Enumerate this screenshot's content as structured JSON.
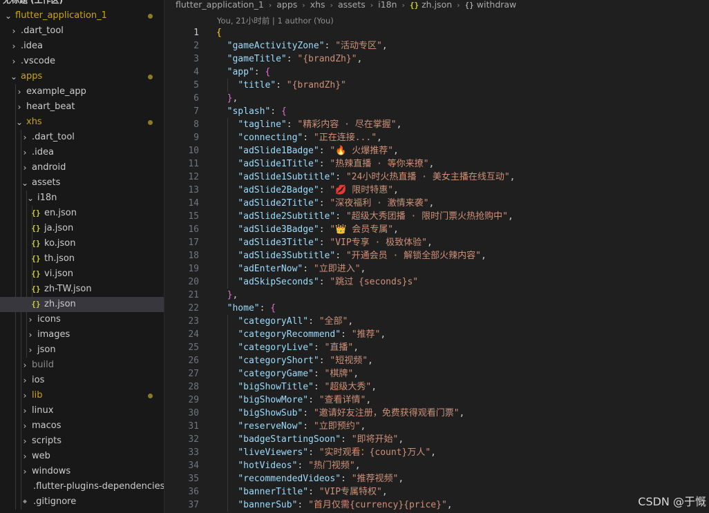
{
  "sidebar": {
    "workspace_label": "无标题 (工作区)",
    "tree": [
      {
        "label": "flutter_application_1",
        "depth": 0,
        "type": "folder",
        "open": true,
        "git": true,
        "dot": true
      },
      {
        "label": ".dart_tool",
        "depth": 1,
        "type": "folder",
        "open": false
      },
      {
        "label": ".idea",
        "depth": 1,
        "type": "folder",
        "open": false
      },
      {
        "label": ".vscode",
        "depth": 1,
        "type": "folder",
        "open": false
      },
      {
        "label": "apps",
        "depth": 1,
        "type": "folder",
        "open": true,
        "git": true,
        "dot": true
      },
      {
        "label": "example_app",
        "depth": 2,
        "type": "folder",
        "open": false
      },
      {
        "label": "heart_beat",
        "depth": 2,
        "type": "folder",
        "open": false
      },
      {
        "label": "xhs",
        "depth": 2,
        "type": "folder",
        "open": true,
        "git": true,
        "dot": true
      },
      {
        "label": ".dart_tool",
        "depth": 3,
        "type": "folder",
        "open": false
      },
      {
        "label": ".idea",
        "depth": 3,
        "type": "folder",
        "open": false
      },
      {
        "label": "android",
        "depth": 3,
        "type": "folder",
        "open": false
      },
      {
        "label": "assets",
        "depth": 3,
        "type": "folder",
        "open": true
      },
      {
        "label": "i18n",
        "depth": 4,
        "type": "folder",
        "open": true
      },
      {
        "label": "en.json",
        "depth": 5,
        "type": "json"
      },
      {
        "label": "ja.json",
        "depth": 5,
        "type": "json"
      },
      {
        "label": "ko.json",
        "depth": 5,
        "type": "json"
      },
      {
        "label": "th.json",
        "depth": 5,
        "type": "json"
      },
      {
        "label": "vi.json",
        "depth": 5,
        "type": "json"
      },
      {
        "label": "zh-TW.json",
        "depth": 5,
        "type": "json"
      },
      {
        "label": "zh.json",
        "depth": 5,
        "type": "json",
        "selected": true
      },
      {
        "label": "icons",
        "depth": 4,
        "type": "folder",
        "open": false
      },
      {
        "label": "images",
        "depth": 4,
        "type": "folder",
        "open": false
      },
      {
        "label": "json",
        "depth": 4,
        "type": "folder",
        "open": false
      },
      {
        "label": "build",
        "depth": 3,
        "type": "folder",
        "open": false,
        "dim": true
      },
      {
        "label": "ios",
        "depth": 3,
        "type": "folder",
        "open": false
      },
      {
        "label": "lib",
        "depth": 3,
        "type": "folder",
        "open": false,
        "git": true,
        "dot": true
      },
      {
        "label": "linux",
        "depth": 3,
        "type": "folder",
        "open": false
      },
      {
        "label": "macos",
        "depth": 3,
        "type": "folder",
        "open": false
      },
      {
        "label": "scripts",
        "depth": 3,
        "type": "folder",
        "open": false
      },
      {
        "label": "web",
        "depth": 3,
        "type": "folder",
        "open": false
      },
      {
        "label": "windows",
        "depth": 3,
        "type": "folder",
        "open": false
      },
      {
        "label": ".flutter-plugins-dependencies",
        "depth": 3,
        "type": "file"
      },
      {
        "label": ".gitignore",
        "depth": 3,
        "type": "gitfile"
      }
    ]
  },
  "breadcrumb": {
    "items": [
      "flutter_application_1",
      "apps",
      "xhs",
      "assets",
      "i18n"
    ],
    "file": "zh.json",
    "symbol": "withdraw",
    "json_glyph": "{}"
  },
  "blame": "You, 21小时前 | 1 author (You)",
  "code": {
    "lines": [
      {
        "n": 1,
        "indent": 0,
        "tokens": [
          [
            "b1",
            "{"
          ]
        ]
      },
      {
        "n": 2,
        "indent": 1,
        "tokens": [
          [
            "k",
            "\"gameActivityZone\""
          ],
          [
            "p",
            ": "
          ],
          [
            "s",
            "\"活动专区\""
          ],
          [
            "p",
            ","
          ]
        ]
      },
      {
        "n": 3,
        "indent": 1,
        "tokens": [
          [
            "k",
            "\"gameTitle\""
          ],
          [
            "p",
            ": "
          ],
          [
            "s",
            "\"{brandZh}\""
          ],
          [
            "p",
            ","
          ]
        ]
      },
      {
        "n": 4,
        "indent": 1,
        "tokens": [
          [
            "k",
            "\"app\""
          ],
          [
            "p",
            ": "
          ],
          [
            "b2",
            "{"
          ]
        ]
      },
      {
        "n": 5,
        "indent": 2,
        "tokens": [
          [
            "k",
            "\"title\""
          ],
          [
            "p",
            ": "
          ],
          [
            "s",
            "\"{brandZh}\""
          ]
        ]
      },
      {
        "n": 6,
        "indent": 1,
        "tokens": [
          [
            "b2",
            "}"
          ],
          [
            "p",
            ","
          ]
        ]
      },
      {
        "n": 7,
        "indent": 1,
        "tokens": [
          [
            "k",
            "\"splash\""
          ],
          [
            "p",
            ": "
          ],
          [
            "b2",
            "{"
          ]
        ]
      },
      {
        "n": 8,
        "indent": 2,
        "tokens": [
          [
            "k",
            "\"tagline\""
          ],
          [
            "p",
            ": "
          ],
          [
            "s",
            "\"精彩内容 · 尽在掌握\""
          ],
          [
            "p",
            ","
          ]
        ]
      },
      {
        "n": 9,
        "indent": 2,
        "tokens": [
          [
            "k",
            "\"connecting\""
          ],
          [
            "p",
            ": "
          ],
          [
            "s",
            "\"正在连接...\""
          ],
          [
            "p",
            ","
          ]
        ]
      },
      {
        "n": 10,
        "indent": 2,
        "tokens": [
          [
            "k",
            "\"adSlide1Badge\""
          ],
          [
            "p",
            ": "
          ],
          [
            "s",
            "\"🔥 火爆推荐\""
          ],
          [
            "p",
            ","
          ]
        ]
      },
      {
        "n": 11,
        "indent": 2,
        "tokens": [
          [
            "k",
            "\"adSlide1Title\""
          ],
          [
            "p",
            ": "
          ],
          [
            "s",
            "\"热辣直播 · 等你来撩\""
          ],
          [
            "p",
            ","
          ]
        ]
      },
      {
        "n": 12,
        "indent": 2,
        "tokens": [
          [
            "k",
            "\"adSlide1Subtitle\""
          ],
          [
            "p",
            ": "
          ],
          [
            "s",
            "\"24小时火热直播 · 美女主播在线互动\""
          ],
          [
            "p",
            ","
          ]
        ]
      },
      {
        "n": 13,
        "indent": 2,
        "tokens": [
          [
            "k",
            "\"adSlide2Badge\""
          ],
          [
            "p",
            ": "
          ],
          [
            "s",
            "\"💋 限时特惠\""
          ],
          [
            "p",
            ","
          ]
        ]
      },
      {
        "n": 14,
        "indent": 2,
        "tokens": [
          [
            "k",
            "\"adSlide2Title\""
          ],
          [
            "p",
            ": "
          ],
          [
            "s",
            "\"深夜福利 · 激情来袭\""
          ],
          [
            "p",
            ","
          ]
        ]
      },
      {
        "n": 15,
        "indent": 2,
        "tokens": [
          [
            "k",
            "\"adSlide2Subtitle\""
          ],
          [
            "p",
            ": "
          ],
          [
            "s",
            "\"超级大秀团播 · 限时门票火热抢购中\""
          ],
          [
            "p",
            ","
          ]
        ]
      },
      {
        "n": 16,
        "indent": 2,
        "tokens": [
          [
            "k",
            "\"adSlide3Badge\""
          ],
          [
            "p",
            ": "
          ],
          [
            "s",
            "\"👑 会员专属\""
          ],
          [
            "p",
            ","
          ]
        ]
      },
      {
        "n": 17,
        "indent": 2,
        "tokens": [
          [
            "k",
            "\"adSlide3Title\""
          ],
          [
            "p",
            ": "
          ],
          [
            "s",
            "\"VIP专享 · 极致体验\""
          ],
          [
            "p",
            ","
          ]
        ]
      },
      {
        "n": 18,
        "indent": 2,
        "tokens": [
          [
            "k",
            "\"adSlide3Subtitle\""
          ],
          [
            "p",
            ": "
          ],
          [
            "s",
            "\"开通会员 · 解锁全部火辣内容\""
          ],
          [
            "p",
            ","
          ]
        ]
      },
      {
        "n": 19,
        "indent": 2,
        "tokens": [
          [
            "k",
            "\"adEnterNow\""
          ],
          [
            "p",
            ": "
          ],
          [
            "s",
            "\"立即进入\""
          ],
          [
            "p",
            ","
          ]
        ]
      },
      {
        "n": 20,
        "indent": 2,
        "tokens": [
          [
            "k",
            "\"adSkipSeconds\""
          ],
          [
            "p",
            ": "
          ],
          [
            "s",
            "\"跳过 {seconds}s\""
          ]
        ]
      },
      {
        "n": 21,
        "indent": 1,
        "tokens": [
          [
            "b2",
            "}"
          ],
          [
            "p",
            ","
          ]
        ]
      },
      {
        "n": 22,
        "indent": 1,
        "tokens": [
          [
            "k",
            "\"home\""
          ],
          [
            "p",
            ": "
          ],
          [
            "b2",
            "{"
          ]
        ]
      },
      {
        "n": 23,
        "indent": 2,
        "tokens": [
          [
            "k",
            "\"categoryAll\""
          ],
          [
            "p",
            ": "
          ],
          [
            "s",
            "\"全部\""
          ],
          [
            "p",
            ","
          ]
        ]
      },
      {
        "n": 24,
        "indent": 2,
        "tokens": [
          [
            "k",
            "\"categoryRecommend\""
          ],
          [
            "p",
            ": "
          ],
          [
            "s",
            "\"推荐\""
          ],
          [
            "p",
            ","
          ]
        ]
      },
      {
        "n": 25,
        "indent": 2,
        "tokens": [
          [
            "k",
            "\"categoryLive\""
          ],
          [
            "p",
            ": "
          ],
          [
            "s",
            "\"直播\""
          ],
          [
            "p",
            ","
          ]
        ]
      },
      {
        "n": 26,
        "indent": 2,
        "tokens": [
          [
            "k",
            "\"categoryShort\""
          ],
          [
            "p",
            ": "
          ],
          [
            "s",
            "\"短视频\""
          ],
          [
            "p",
            ","
          ]
        ]
      },
      {
        "n": 27,
        "indent": 2,
        "tokens": [
          [
            "k",
            "\"categoryGame\""
          ],
          [
            "p",
            ": "
          ],
          [
            "s",
            "\"棋牌\""
          ],
          [
            "p",
            ","
          ]
        ]
      },
      {
        "n": 28,
        "indent": 2,
        "tokens": [
          [
            "k",
            "\"bigShowTitle\""
          ],
          [
            "p",
            ": "
          ],
          [
            "s",
            "\"超级大秀\""
          ],
          [
            "p",
            ","
          ]
        ]
      },
      {
        "n": 29,
        "indent": 2,
        "tokens": [
          [
            "k",
            "\"bigShowMore\""
          ],
          [
            "p",
            ": "
          ],
          [
            "s",
            "\"查看详情\""
          ],
          [
            "p",
            ","
          ]
        ]
      },
      {
        "n": 30,
        "indent": 2,
        "tokens": [
          [
            "k",
            "\"bigShowSub\""
          ],
          [
            "p",
            ": "
          ],
          [
            "s",
            "\"邀请好友注册，免费获得观看门票\""
          ],
          [
            "p",
            ","
          ]
        ]
      },
      {
        "n": 31,
        "indent": 2,
        "tokens": [
          [
            "k",
            "\"reserveNow\""
          ],
          [
            "p",
            ": "
          ],
          [
            "s",
            "\"立即预约\""
          ],
          [
            "p",
            ","
          ]
        ]
      },
      {
        "n": 32,
        "indent": 2,
        "tokens": [
          [
            "k",
            "\"badgeStartingSoon\""
          ],
          [
            "p",
            ": "
          ],
          [
            "s",
            "\"即将开始\""
          ],
          [
            "p",
            ","
          ]
        ]
      },
      {
        "n": 33,
        "indent": 2,
        "tokens": [
          [
            "k",
            "\"liveViewers\""
          ],
          [
            "p",
            ": "
          ],
          [
            "s",
            "\"实时观看：{count}万人\""
          ],
          [
            "p",
            ","
          ]
        ]
      },
      {
        "n": 34,
        "indent": 2,
        "tokens": [
          [
            "k",
            "\"hotVideos\""
          ],
          [
            "p",
            ": "
          ],
          [
            "s",
            "\"热门视频\""
          ],
          [
            "p",
            ","
          ]
        ]
      },
      {
        "n": 35,
        "indent": 2,
        "tokens": [
          [
            "k",
            "\"recommendedVideos\""
          ],
          [
            "p",
            ": "
          ],
          [
            "s",
            "\"推荐视频\""
          ],
          [
            "p",
            ","
          ]
        ]
      },
      {
        "n": 36,
        "indent": 2,
        "tokens": [
          [
            "k",
            "\"bannerTitle\""
          ],
          [
            "p",
            ": "
          ],
          [
            "s",
            "\"VIP专属特权\""
          ],
          [
            "p",
            ","
          ]
        ]
      },
      {
        "n": 37,
        "indent": 2,
        "tokens": [
          [
            "k",
            "\"bannerSub\""
          ],
          [
            "p",
            ": "
          ],
          [
            "s",
            "\"首月仅需{currency}{price}\""
          ],
          [
            "p",
            ","
          ]
        ]
      }
    ]
  },
  "watermark": "CSDN @于慨",
  "colors": {
    "key": "#9cdcfe",
    "string": "#ce9178",
    "bracket1": "#ffd700",
    "bracket2": "#da70d6",
    "git_modified": "#cca700"
  }
}
